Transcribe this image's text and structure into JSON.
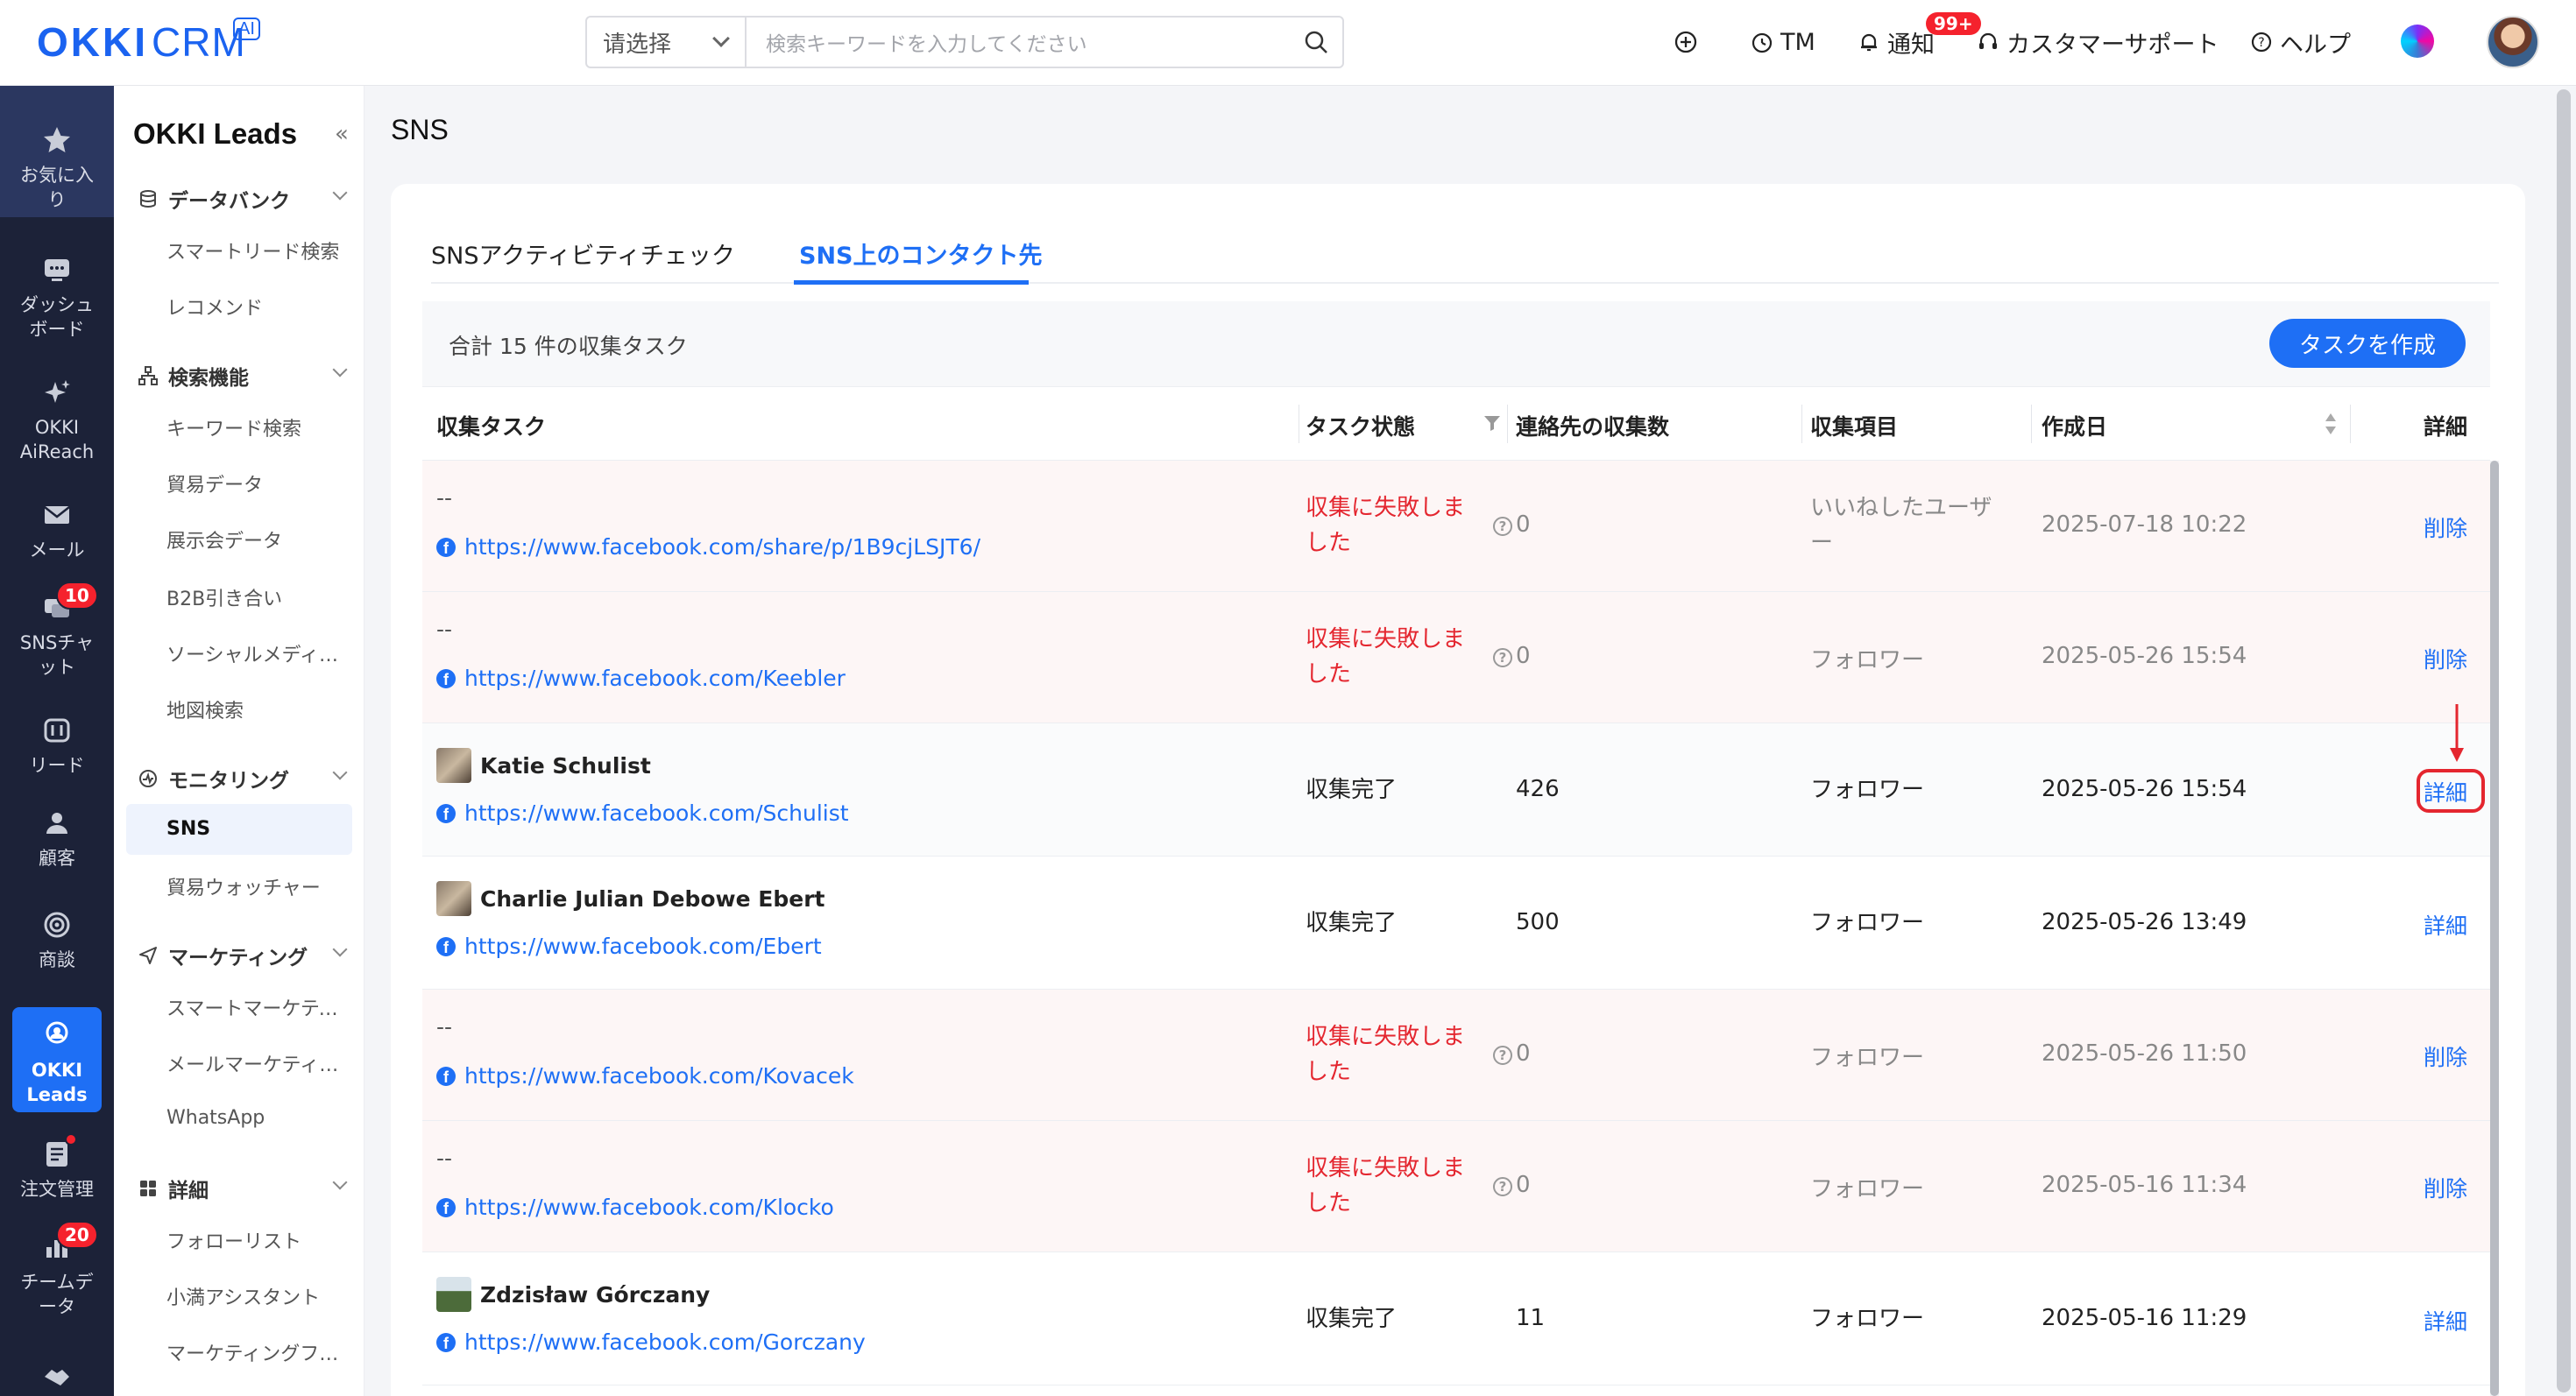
{
  "logo": {
    "brand": "OKKI",
    "product": "CRM",
    "ai": "AI"
  },
  "search": {
    "select": "请选择",
    "placeholder": "検索キーワードを入力してください"
  },
  "topbar": {
    "tm": "TM",
    "notice": "通知",
    "notice_badge": "99+",
    "support": "カスタマーサポート",
    "help": "ヘルプ"
  },
  "nav": [
    {
      "label": "お気に入り"
    },
    {
      "label": "ダッシュボード"
    },
    {
      "label": "OKKI AiReach"
    },
    {
      "label": "メール"
    },
    {
      "label": "SNSチャット",
      "badge": "10"
    },
    {
      "label": "リード"
    },
    {
      "label": "顧客"
    },
    {
      "label": "商談"
    },
    {
      "label": "OKKI Leads"
    },
    {
      "label": "注文管理"
    },
    {
      "label": "チームデータ",
      "badge": "20"
    }
  ],
  "side": {
    "title": "OKKI Leads",
    "collapse": "«",
    "sections": [
      {
        "label": "データバンク",
        "items": [
          "スマートリード検索",
          "レコメンド"
        ]
      },
      {
        "label": "検索機能",
        "items": [
          "キーワード検索",
          "貿易データ",
          "展示会データ",
          "B2B引き合い",
          "ソーシャルメディア検索",
          "地図検索"
        ]
      },
      {
        "label": "モニタリング",
        "items": [
          "SNS",
          "貿易ウォッチャー"
        ]
      },
      {
        "label": "マーケティング",
        "items": [
          "スマートマーケティング",
          "メールマーケティング",
          "WhatsApp"
        ]
      },
      {
        "label": "詳細",
        "items": [
          "フォローリスト",
          "小満アシスタント",
          "マーケティングフォーム"
        ]
      }
    ]
  },
  "page": {
    "title": "SNS"
  },
  "tabs": [
    "SNSアクティビティチェック",
    "SNS上のコンタクト先"
  ],
  "toolbar": {
    "total": "合計 15 件の収集タスク",
    "create": "タスクを作成"
  },
  "columns": [
    "収集タスク",
    "タスク状態",
    "連絡先の収集数",
    "収集項目",
    "作成日",
    "詳細"
  ],
  "rows": [
    {
      "name": "--",
      "url": "https://www.facebook.com/share/p/1B9cjLSJT6/",
      "status": "収集に失敗しました",
      "count": "0",
      "item": "いいねしたユーザー",
      "date": "2025-07-18 10:22",
      "action": "削除"
    },
    {
      "name": "--",
      "url": "https://www.facebook.com/Keebler",
      "status": "収集に失敗しました",
      "count": "0",
      "item": "フォロワー",
      "date": "2025-05-26 15:54",
      "action": "削除"
    },
    {
      "name": "Katie Schulist",
      "url": "https://www.facebook.com/Schulist",
      "status": "収集完了",
      "count": "426",
      "item": "フォロワー",
      "date": "2025-05-26 15:54",
      "action": "詳細"
    },
    {
      "name": "Charlie Julian Debowe Ebert",
      "url": "https://www.facebook.com/Ebert",
      "status": "収集完了",
      "count": "500",
      "item": "フォロワー",
      "date": "2025-05-26 13:49",
      "action": "詳細"
    },
    {
      "name": "--",
      "url": "https://www.facebook.com/Kovacek",
      "status": "収集に失敗しました",
      "count": "0",
      "item": "フォロワー",
      "date": "2025-05-26 11:50",
      "action": "削除"
    },
    {
      "name": "--",
      "url": "https://www.facebook.com/Klocko",
      "status": "収集に失敗しました",
      "count": "0",
      "item": "フォロワー",
      "date": "2025-05-16 11:34",
      "action": "削除"
    },
    {
      "name": "Zdzisław Górczany",
      "url": "https://www.facebook.com/Gorczany",
      "status": "収集完了",
      "count": "11",
      "item": "フォロワー",
      "date": "2025-05-16 11:29",
      "action": "詳細"
    }
  ],
  "colors": {
    "brand": "#1b63f0",
    "primary": "#1e6ff5",
    "fail": "#e4262f",
    "nav_bg": "#1c2238",
    "highlight": "#e4262f"
  }
}
